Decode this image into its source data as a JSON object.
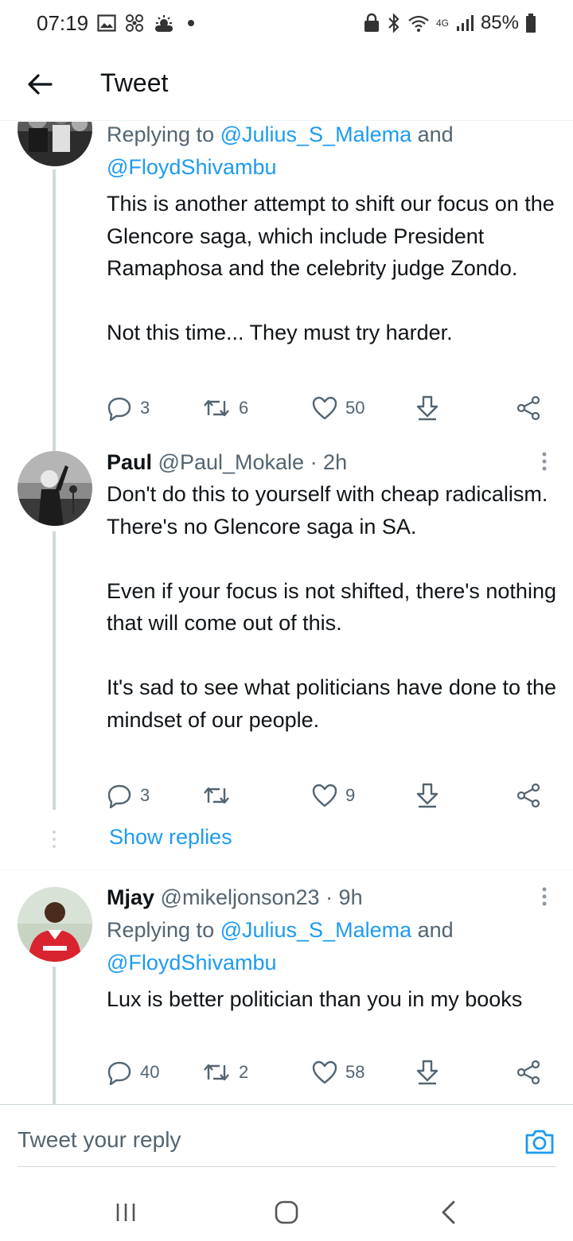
{
  "status_bar": {
    "time": "07:19",
    "battery": "85%",
    "network": "4G"
  },
  "header": {
    "title": "Tweet"
  },
  "tweets": [
    {
      "reply_prefix": "Replying to ",
      "mention1": "@Julius_S_Malema",
      "conj": " and",
      "mention2": "@FloydShivambu",
      "text": "This is another attempt to shift our focus on the Glencore saga, which include President Ramaphosa and the celebrity judge Zondo.\n\nNot this time... They must try harder.",
      "replies": "3",
      "retweets": "6",
      "likes": "50"
    },
    {
      "name": "Paul",
      "handle": "@Paul_Mokale",
      "time": " · 2h",
      "text": "Don't do this to yourself with cheap radicalism.\nThere's no Glencore saga in SA.\n\nEven if your focus is not shifted, there's nothing that will come out of this.\n\nIt's sad to see what politicians have done to the mindset of our people.",
      "replies": "3",
      "retweets": "",
      "likes": "9",
      "show_replies": "Show replies"
    },
    {
      "name": "Mjay",
      "handle": "@mikeljonson23",
      "time": " · 9h",
      "reply_prefix": "Replying to ",
      "mention1": "@Julius_S_Malema",
      "conj": " and",
      "mention2": "@FloydShivambu",
      "text": "Lux is better politician than you in my books",
      "replies": "40",
      "retweets": "2",
      "likes": "58"
    }
  ],
  "reply_bar": {
    "placeholder": "Tweet your reply"
  },
  "colors": {
    "accent": "#1d9bf0",
    "secondary_text": "#536471",
    "thread_line": "#cfd9de"
  }
}
